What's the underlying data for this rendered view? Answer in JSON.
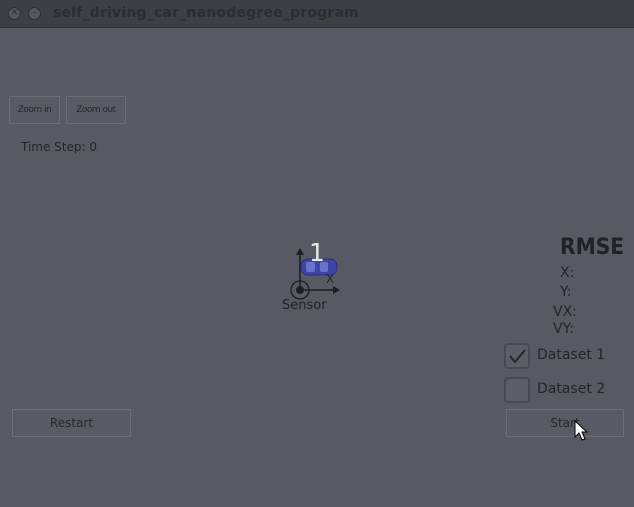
{
  "window": {
    "title": "self_driving_car_nanodegree_program"
  },
  "toolbar": {
    "zoom_in_label": "Zoom in",
    "zoom_out_label": "Zoom out"
  },
  "status": {
    "time_step": "Time Step: 0"
  },
  "scene": {
    "car_index": "1",
    "sensor_label": "Sensor",
    "axis_x_label": "X",
    "car_color": "#3f45a8"
  },
  "rmse": {
    "title": "RMSE",
    "x_label": "X:",
    "y_label": "Y:",
    "vx_label": "VX:",
    "vy_label": "VY:"
  },
  "datasets": [
    {
      "label": "Dataset 1",
      "checked": true
    },
    {
      "label": "Dataset 2",
      "checked": false
    }
  ],
  "controls": {
    "restart_label": "Restart",
    "start_label": "Start"
  },
  "colors": {
    "background": "#575a63",
    "titlebar": "#3d3f45"
  }
}
